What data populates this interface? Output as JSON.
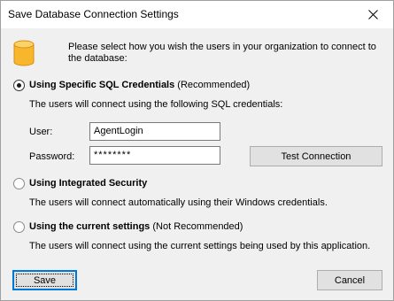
{
  "window": {
    "title": "Save Database Connection Settings"
  },
  "icons": {
    "close": "close-icon",
    "database": "database-icon",
    "database_color": "#f7b62b"
  },
  "intro_text": "Please select how you wish the users in your organization to connect to the database:",
  "options": {
    "specific": {
      "label": "Using Specific SQL Credentials",
      "suffix": "(Recommended)",
      "selected": true,
      "description": "The users will connect using the following SQL credentials:"
    },
    "integrated": {
      "label": "Using Integrated Security",
      "suffix": "",
      "selected": false,
      "description": "The users will connect automatically using their Windows credentials."
    },
    "current": {
      "label": "Using the current settings",
      "suffix": "(Not Recommended)",
      "selected": false,
      "description": "The users will connect using the current settings being used by this application."
    }
  },
  "credentials": {
    "user_label": "User:",
    "user_value": "AgentLogin",
    "password_label": "Password:",
    "password_value": "********"
  },
  "buttons": {
    "test_connection": "Test Connection",
    "save": "Save",
    "cancel": "Cancel"
  }
}
